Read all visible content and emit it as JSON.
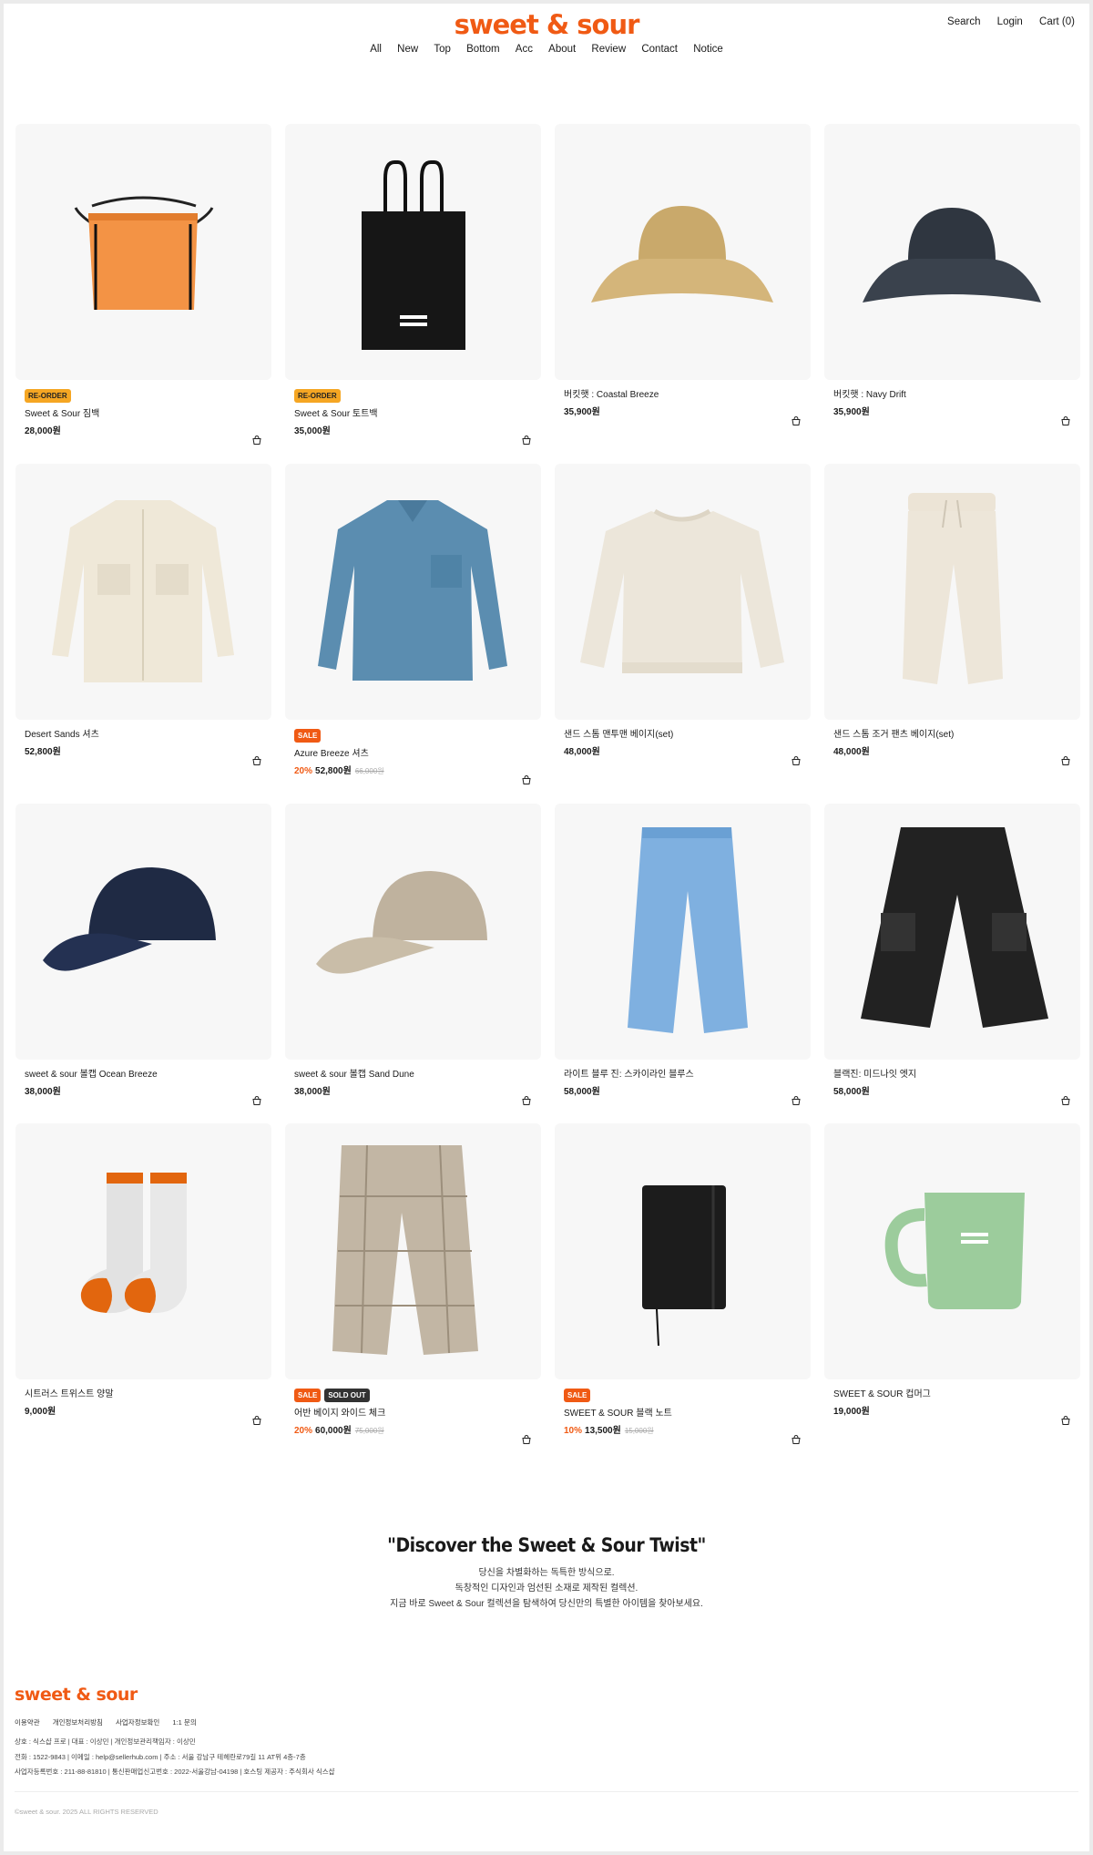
{
  "header": {
    "logo": "sweet & sour",
    "util": [
      "Search",
      "Login",
      "Cart (0)"
    ],
    "nav": [
      "All",
      "New",
      "Top",
      "Bottom",
      "Acc",
      "About",
      "Review",
      "Contact",
      "Notice"
    ]
  },
  "products": [
    {
      "name": "Sweet & Sour 짐백",
      "price": "28,000원",
      "badges": [
        "RE-ORDER"
      ],
      "icon": "drawstring-bag"
    },
    {
      "name": "Sweet & Sour 토트백",
      "price": "35,000원",
      "badges": [
        "RE-ORDER"
      ],
      "icon": "tote-bag"
    },
    {
      "name": "버킷햇 : Coastal Breeze",
      "price": "35,900원",
      "badges": [],
      "icon": "bucket-hat-tan"
    },
    {
      "name": "버킷햇 : Navy Drift",
      "price": "35,900원",
      "badges": [],
      "icon": "bucket-hat-navy"
    },
    {
      "name": "Desert Sands 셔츠",
      "price": "52,800원",
      "badges": [],
      "icon": "shirt-cream"
    },
    {
      "name": "Azure Breeze 셔츠",
      "price": "52,800원",
      "discount": "20%",
      "original": "66,000원",
      "badges": [
        "SALE"
      ],
      "icon": "shirt-blue"
    },
    {
      "name": "샌드 스톰 맨투맨 베이지(set)",
      "price": "48,000원",
      "badges": [],
      "icon": "sweatshirt"
    },
    {
      "name": "샌드 스톰 조거 팬츠 베이지(set)",
      "price": "48,000원",
      "badges": [],
      "icon": "jogger-pants"
    },
    {
      "name": "sweet & sour 볼캡 Ocean Breeze",
      "price": "38,000원",
      "badges": [],
      "icon": "cap-navy"
    },
    {
      "name": "sweet & sour 볼캡 Sand Dune",
      "price": "38,000원",
      "badges": [],
      "icon": "cap-beige"
    },
    {
      "name": "라이트 블루 진: 스카이라인 블루스",
      "price": "58,000원",
      "badges": [],
      "icon": "jeans-light"
    },
    {
      "name": "블랙진: 미드나잇 엣지",
      "price": "58,000원",
      "badges": [],
      "icon": "cargo-black"
    },
    {
      "name": "시트러스 트위스트 양말",
      "price": "9,000원",
      "badges": [],
      "icon": "socks"
    },
    {
      "name": "어반 베이지 와이드 체크",
      "price": "60,000원",
      "discount": "20%",
      "original": "75,000원",
      "badges": [
        "SALE",
        "SOLD OUT"
      ],
      "icon": "check-pants"
    },
    {
      "name": "SWEET & SOUR 블랙 노트",
      "price": "13,500원",
      "discount": "10%",
      "original": "15,000원",
      "badges": [
        "SALE"
      ],
      "icon": "notebook"
    },
    {
      "name": "SWEET & SOUR 컵머그",
      "price": "19,000원",
      "badges": [],
      "icon": "mug"
    }
  ],
  "promo": {
    "title": "\"Discover the Sweet & Sour Twist\"",
    "line1": "당신을 차별화하는 독특한 방식으로.",
    "line2": "독창적인 디자인과 엄선된 소재로 제작된 컬렉션.",
    "line3": "지금 바로 Sweet & Sour 컬렉션을 탐색하여 당신만의 특별한 아이템을 찾아보세요."
  },
  "footer": {
    "logo": "sweet & sour",
    "links": [
      "이용약관",
      "개인정보처리방침",
      "사업자정보확인",
      "1:1 문의"
    ],
    "info1": "상호 : 식스샵 프로  |  대표 : 이상민  |  개인정보관리책임자 : 이상민",
    "info2": "전화 : 1522-9843  |  이메일 : help@sellerhub.com  |  주소 : 서울 강남구 테헤란로79길 11 AT위 4층-7층",
    "info3": "사업자등록번호 : 211-88-81810  |  통신판매업신고번호 : 2022-서울강남-04198  |  호스팅 제공자 : 주식회사 식스샵",
    "copyright": "©sweet & sour. 2025 ALL RIGHTS RESERVED"
  },
  "colors": {
    "accent": "#f05a14",
    "reorder": "#f5a623",
    "soldout": "#333333"
  }
}
